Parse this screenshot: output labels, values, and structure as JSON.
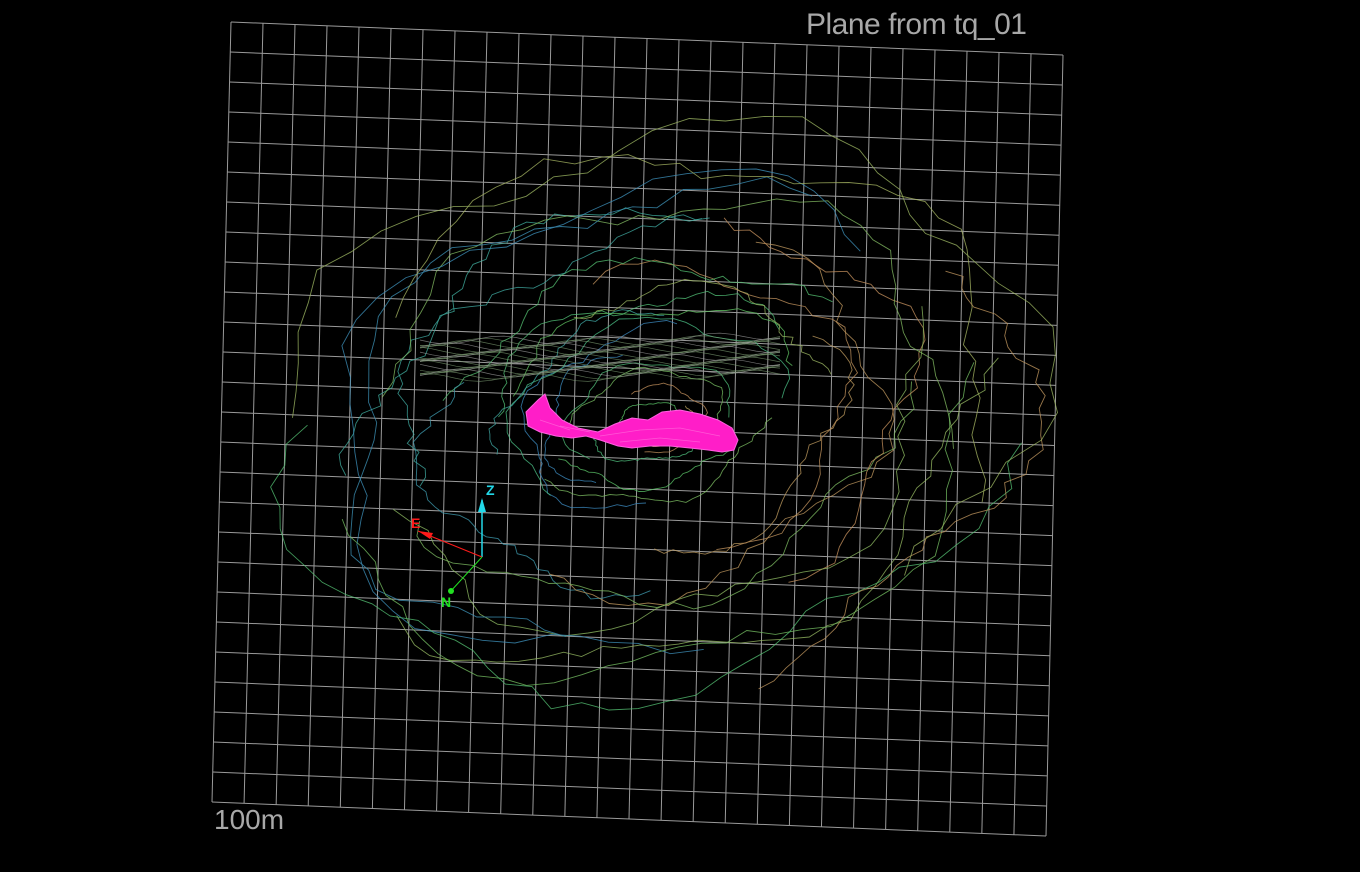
{
  "viewer": {
    "title": "Plane from tq_01",
    "scale_label": "100m",
    "grid_divisions": 26,
    "axes": {
      "z_label": "Z",
      "e_label": "E",
      "n_label": "N"
    },
    "colors": {
      "background": "#000000",
      "grid": "#9a9a9a",
      "solid": "#ff1ec8",
      "axis_z": "#22d8e8",
      "axis_e": "#ff1a1a",
      "axis_n": "#22e022",
      "contour_ramp": [
        "#c8845a",
        "#a8b060",
        "#5cc060",
        "#40b890",
        "#3a7ac8"
      ]
    }
  }
}
